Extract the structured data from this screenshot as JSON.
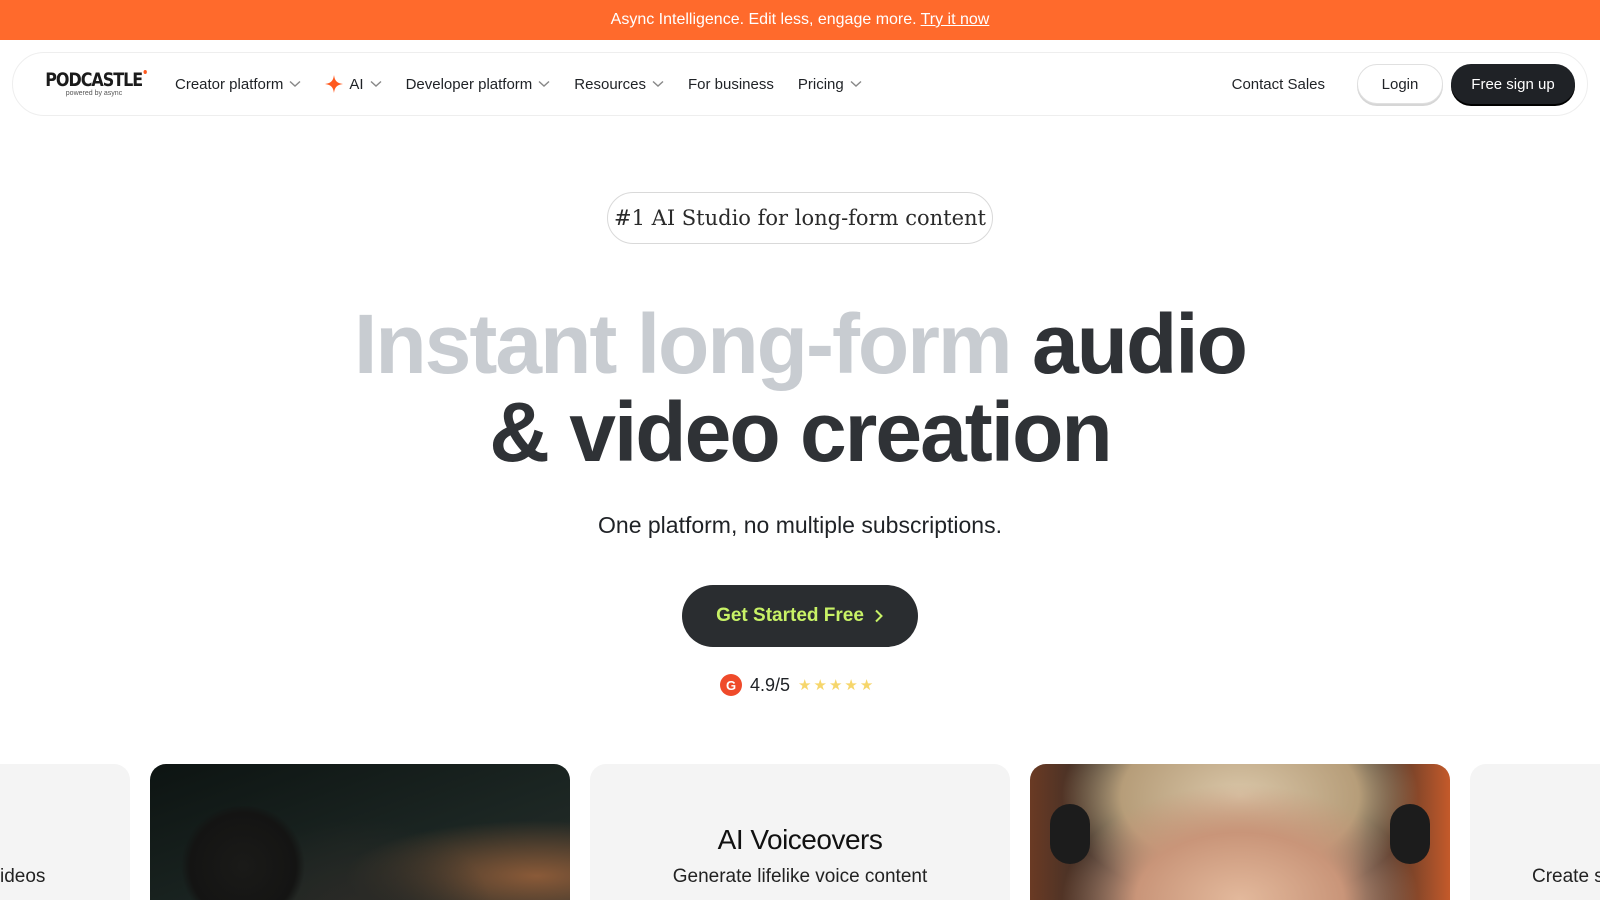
{
  "banner": {
    "text": "Async Intelligence. Edit less, engage more.",
    "link": "Try it now"
  },
  "nav": {
    "logo": {
      "word": "PODCASTLE",
      "sub": "powered by async"
    },
    "items": [
      {
        "label": "Creator platform",
        "dropdown": true
      },
      {
        "label": "AI",
        "dropdown": true,
        "icon": "sparkle-icon"
      },
      {
        "label": "Developer platform",
        "dropdown": true
      },
      {
        "label": "Resources",
        "dropdown": true
      },
      {
        "label": "For business",
        "dropdown": false
      },
      {
        "label": "Pricing",
        "dropdown": true
      }
    ],
    "contact": "Contact Sales",
    "login": "Login",
    "signup": "Free sign up"
  },
  "badge": "#1 AI Studio for long-form content",
  "hero": {
    "light": "Instant long-form",
    "dark1": "audio",
    "dark2": "& video creation"
  },
  "subtitle": "One platform, no multiple subscriptions.",
  "cta": {
    "label": "Get Started Free"
  },
  "rating": {
    "value": "4.9/5",
    "stars": 5,
    "logo": "G"
  },
  "cards": {
    "left_edge_text": "ideos",
    "voiceovers": {
      "title": "AI Voiceovers",
      "subtitle": "Generate lifelike voice content"
    },
    "right_edge_text": "Create s"
  },
  "colors": {
    "banner": "#ff6a2c",
    "dark": "#1f2226",
    "cta_text": "#c8f266",
    "hero_light": "#c8ccd1",
    "star": "#f6d66b",
    "g2": "#ef4a2a"
  }
}
